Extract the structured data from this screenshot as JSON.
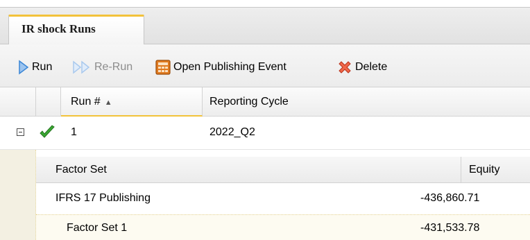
{
  "tab": {
    "label": "IR shock Runs"
  },
  "toolbar": {
    "run_label": "Run",
    "rerun_label": "Re-Run",
    "open_publishing_label": "Open Publishing Event",
    "delete_label": "Delete"
  },
  "grid": {
    "columns": [
      "Run #",
      "Reporting Cycle"
    ],
    "sort": {
      "column": "Run #",
      "direction": "ascending"
    },
    "rows": [
      {
        "status": "success",
        "expanded": true,
        "run_number": "1",
        "reporting_cycle": "2022_Q2"
      }
    ]
  },
  "subgrid": {
    "columns": [
      "Factor Set",
      "Equity"
    ],
    "rows": [
      {
        "factor_set": "IFRS 17 Publishing",
        "equity": "-436,860.71"
      },
      {
        "factor_set": "Factor Set 1",
        "equity": "-431,533.78"
      }
    ]
  },
  "colors": {
    "accent": "#f2c23a",
    "success": "#3aa832",
    "delete": "#e2452b",
    "run": "#3a86d6"
  }
}
